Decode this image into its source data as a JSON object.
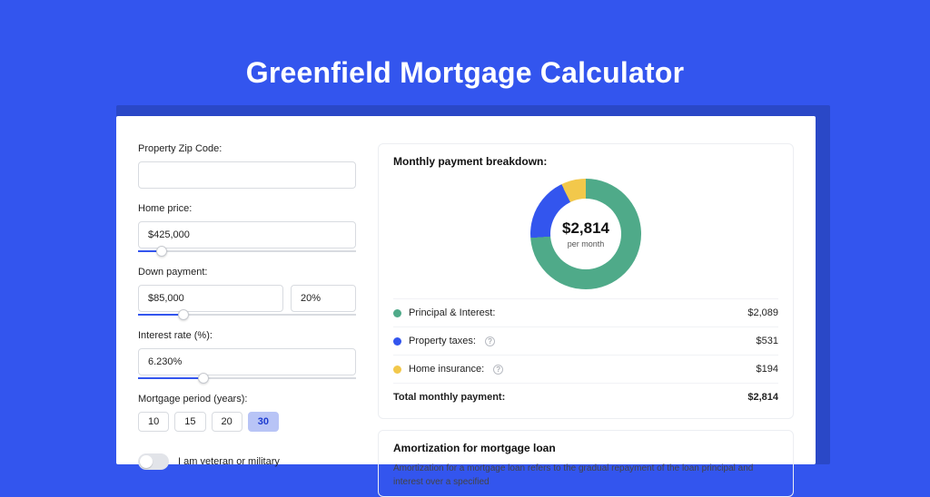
{
  "title": "Greenfield Mortgage Calculator",
  "form": {
    "zip": {
      "label": "Property Zip Code:",
      "value": ""
    },
    "home_price": {
      "label": "Home price:",
      "value": "$425,000",
      "slider_pct": 11
    },
    "down_payment": {
      "label": "Down payment:",
      "amount": "$85,000",
      "percent": "20%",
      "slider_pct": 21
    },
    "interest_rate": {
      "label": "Interest rate (%):",
      "value": "6.230%",
      "slider_pct": 30
    },
    "period": {
      "label": "Mortgage period (years):",
      "options": [
        "10",
        "15",
        "20",
        "30"
      ],
      "selected": "30"
    },
    "veteran": {
      "label": "I am veteran or military",
      "value": false
    }
  },
  "breakdown": {
    "title": "Monthly payment breakdown:",
    "center_amount": "$2,814",
    "center_sub": "per month",
    "rows": [
      {
        "color": "green",
        "label": "Principal & Interest:",
        "info": false,
        "amount": "$2,089"
      },
      {
        "color": "blue",
        "label": "Property taxes:",
        "info": true,
        "amount": "$531"
      },
      {
        "color": "yellow",
        "label": "Home insurance:",
        "info": true,
        "amount": "$194"
      }
    ],
    "total": {
      "label": "Total monthly payment:",
      "amount": "$2,814"
    }
  },
  "amortization": {
    "title": "Amortization for mortgage loan",
    "text": "Amortization for a mortgage loan refers to the gradual repayment of the loan principal and interest over a specified"
  },
  "chart_data": {
    "type": "pie",
    "title": "Monthly payment breakdown",
    "series": [
      {
        "name": "Principal & Interest",
        "value": 2089,
        "color": "#4faa89"
      },
      {
        "name": "Property taxes",
        "value": 531,
        "color": "#3355ee"
      },
      {
        "name": "Home insurance",
        "value": 194,
        "color": "#f2c84b"
      }
    ],
    "total": 2814,
    "unit": "USD/month"
  }
}
